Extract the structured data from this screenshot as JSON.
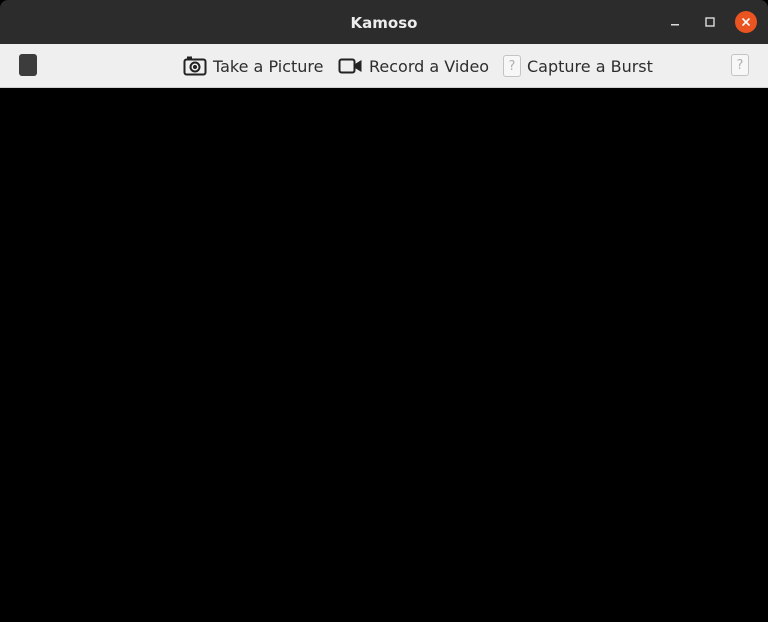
{
  "window": {
    "title": "Kamoso",
    "controls": {
      "minimize_icon": "minimize-icon",
      "maximize_icon": "maximize-icon",
      "close_icon": "close-icon",
      "close_color": "#e95420"
    }
  },
  "toolbar": {
    "take_picture_label": "Take a Picture",
    "record_video_label": "Record a Video",
    "capture_burst_label": "Capture a Burst",
    "missing_icon_glyph": "?"
  },
  "colors": {
    "titlebar": "#2c2c2c",
    "toolbar": "#efefef",
    "viewport": "#000000",
    "accent": "#e95420"
  }
}
